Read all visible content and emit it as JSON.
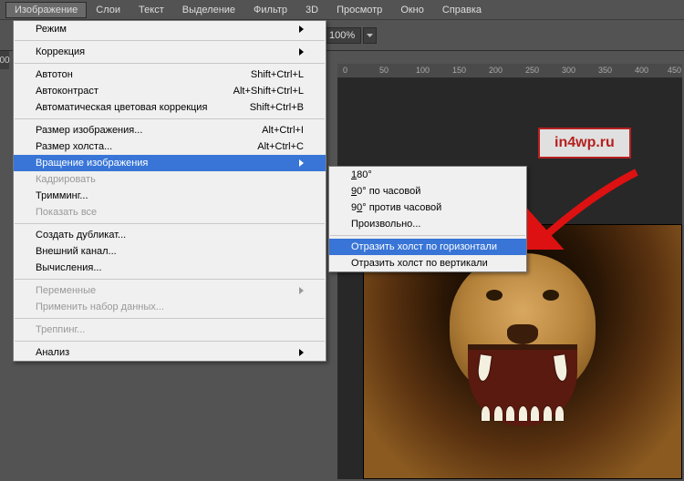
{
  "menubar": {
    "items": [
      "Изображение",
      "Слои",
      "Текст",
      "Выделение",
      "Фильтр",
      "3D",
      "Просмотр",
      "Окно",
      "Справка"
    ],
    "active_index": 0
  },
  "toolbar": {
    "zoom": "100%"
  },
  "left_value": "00",
  "ruler": {
    "marks": [
      0,
      50,
      100,
      150,
      200,
      250,
      300,
      350,
      400,
      450
    ]
  },
  "menu": {
    "mode": "Режим",
    "correction": "Коррекция",
    "autotone": "Автотон",
    "autotone_sc": "Shift+Ctrl+L",
    "autocontrast": "Автоконтраст",
    "autocontrast_sc": "Alt+Shift+Ctrl+L",
    "autocolor": "Автоматическая цветовая коррекция",
    "autocolor_sc": "Shift+Ctrl+B",
    "img_size": "Размер изображения...",
    "img_size_sc": "Alt+Ctrl+I",
    "canvas_size": "Размер холста...",
    "canvas_size_sc": "Alt+Ctrl+C",
    "rotate": "Вращение изображения",
    "crop": "Кадрировать",
    "trim": "Тримминг...",
    "reveal": "Показать все",
    "duplicate": "Создать дубликат...",
    "external": "Внешний канал...",
    "calc": "Вычисления...",
    "variables": "Переменные",
    "apply_dataset": "Применить набор данных...",
    "trapping": "Треппинг...",
    "analysis": "Анализ"
  },
  "submenu": {
    "d180": "180°",
    "cw": "90° по часовой",
    "ccw": "90° против часовой",
    "arbitrary": "Произвольно...",
    "flip_h": "Отразить холст по горизонтали",
    "flip_v": "Отразить холст по вертикали"
  },
  "watermark": "in4wp.ru"
}
